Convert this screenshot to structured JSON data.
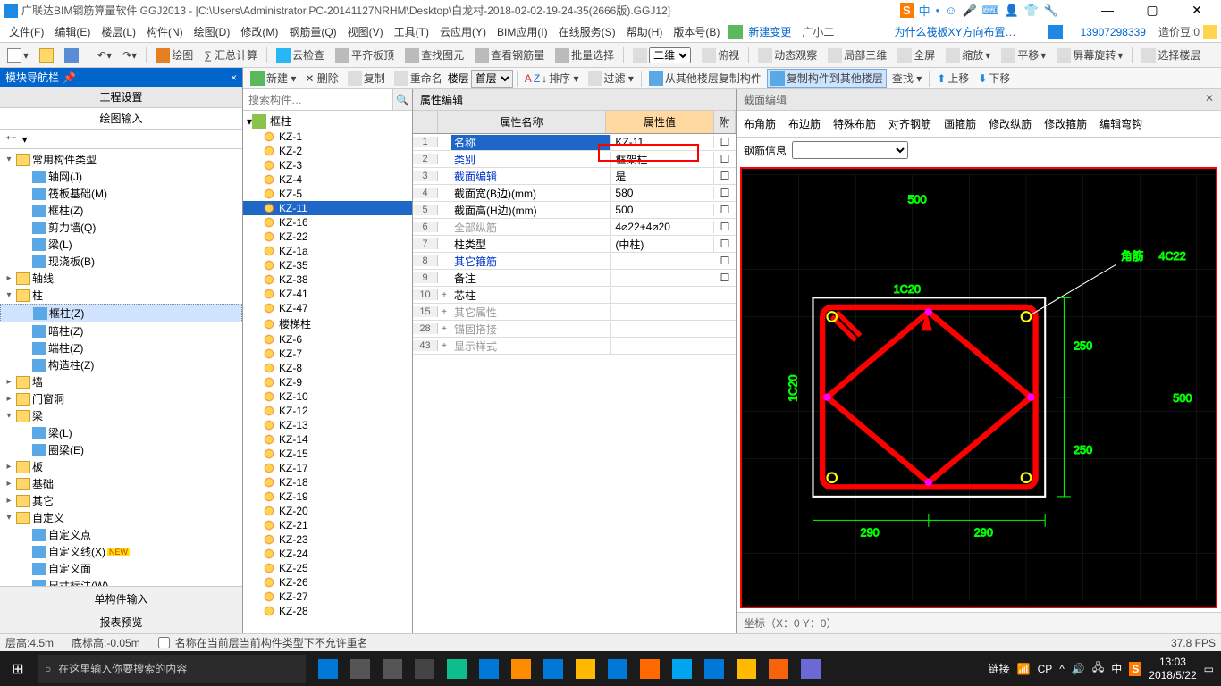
{
  "titlebar": {
    "app_icon": "app",
    "title": "广联达BIM钢筋算量软件 GGJ2013 - [C:\\Users\\Administrator.PC-20141127NRHM\\Desktop\\白龙村-2018-02-02-19-24-35(2666版).GGJ12]",
    "ime": [
      "中",
      "•",
      "☺",
      "🎤",
      "⌨",
      "👤",
      "👕",
      "🔧"
    ]
  },
  "menus": [
    "文件(F)",
    "编辑(E)",
    "楼层(L)",
    "构件(N)",
    "绘图(D)",
    "修改(M)",
    "钢筋量(Q)",
    "视图(V)",
    "工具(T)",
    "云应用(Y)",
    "BIM应用(I)",
    "在线服务(S)",
    "帮助(H)",
    "版本号(B)"
  ],
  "menu_right": {
    "new_change": "新建变更",
    "agent": "广小二",
    "ad": "为什么筏板XY方向布置…",
    "user": "13907298339",
    "coin_label": "造价豆:0"
  },
  "maintool": [
    "新建",
    "打开",
    "保存",
    "撤销",
    "重做",
    "",
    "绘图",
    "∑ 汇总计算",
    "",
    "云检查",
    "",
    "平齐板顶",
    "",
    "查找图元",
    "",
    "查看钢筋量",
    "",
    "批量选择",
    "",
    "二维",
    "",
    "俯视",
    "",
    "动态观察",
    "",
    "局部三维",
    "",
    "全屏",
    "",
    "缩放",
    "",
    "平移",
    "",
    "屏幕旋转",
    "",
    "选择楼层"
  ],
  "subtool": {
    "items": [
      "新建 ▾",
      "✕ 删除",
      "复制",
      "重命名"
    ],
    "floor_label": "楼层",
    "floor_value": "首层",
    "sort": "排序 ▾",
    "filter": "过滤 ▾",
    "copyfrom": "从其他楼层复制构件",
    "copyto": "复制构件到其他楼层",
    "find": "查找 ▾",
    "up": "上移",
    "down": "下移"
  },
  "leftpanel": {
    "header": "模块导航栏",
    "tabs": {
      "proj": "工程设置",
      "draw": "绘图输入"
    },
    "tree": [
      {
        "t": "常用构件类型",
        "exp": "-",
        "lvl": 0,
        "ic": "folder"
      },
      {
        "t": "轴网(J)",
        "lvl": 1,
        "ic": "grid"
      },
      {
        "t": "筏板基础(M)",
        "lvl": 1,
        "ic": "comp"
      },
      {
        "t": "框柱(Z)",
        "lvl": 1,
        "ic": "comp"
      },
      {
        "t": "剪力墙(Q)",
        "lvl": 1,
        "ic": "comp"
      },
      {
        "t": "梁(L)",
        "lvl": 1,
        "ic": "comp"
      },
      {
        "t": "现浇板(B)",
        "lvl": 1,
        "ic": "comp"
      },
      {
        "t": "轴线",
        "exp": "+",
        "lvl": 0,
        "ic": "folder"
      },
      {
        "t": "柱",
        "exp": "-",
        "lvl": 0,
        "ic": "folder"
      },
      {
        "t": "框柱(Z)",
        "lvl": 1,
        "ic": "comp",
        "sel": true
      },
      {
        "t": "暗柱(Z)",
        "lvl": 1,
        "ic": "comp"
      },
      {
        "t": "端柱(Z)",
        "lvl": 1,
        "ic": "comp"
      },
      {
        "t": "构造柱(Z)",
        "lvl": 1,
        "ic": "comp"
      },
      {
        "t": "墙",
        "exp": "+",
        "lvl": 0,
        "ic": "folder"
      },
      {
        "t": "门窗洞",
        "exp": "+",
        "lvl": 0,
        "ic": "folder"
      },
      {
        "t": "梁",
        "exp": "-",
        "lvl": 0,
        "ic": "folder"
      },
      {
        "t": "梁(L)",
        "lvl": 1,
        "ic": "comp"
      },
      {
        "t": "圈梁(E)",
        "lvl": 1,
        "ic": "comp"
      },
      {
        "t": "板",
        "exp": "+",
        "lvl": 0,
        "ic": "folder"
      },
      {
        "t": "基础",
        "exp": "+",
        "lvl": 0,
        "ic": "folder"
      },
      {
        "t": "其它",
        "exp": "+",
        "lvl": 0,
        "ic": "folder"
      },
      {
        "t": "自定义",
        "exp": "-",
        "lvl": 0,
        "ic": "folder"
      },
      {
        "t": "自定义点",
        "lvl": 1,
        "ic": "comp"
      },
      {
        "t": "自定义线(X)",
        "lvl": 1,
        "ic": "comp",
        "new": true
      },
      {
        "t": "自定义面",
        "lvl": 1,
        "ic": "comp"
      },
      {
        "t": "尺寸标注(W)",
        "lvl": 1,
        "ic": "comp"
      }
    ],
    "bottom": [
      "单构件输入",
      "报表预览"
    ]
  },
  "complist": {
    "search_ph": "搜索构件…",
    "root": "框柱",
    "items": [
      "KZ-1",
      "KZ-2",
      "KZ-3",
      "KZ-4",
      "KZ-5",
      "KZ-11",
      "KZ-16",
      "KZ-22",
      "KZ-1a",
      "KZ-35",
      "KZ-38",
      "KZ-41",
      "KZ-47",
      "楼梯柱",
      "KZ-6",
      "KZ-7",
      "KZ-8",
      "KZ-9",
      "KZ-10",
      "KZ-12",
      "KZ-13",
      "KZ-14",
      "KZ-15",
      "KZ-17",
      "KZ-18",
      "KZ-19",
      "KZ-20",
      "KZ-21",
      "KZ-23",
      "KZ-24",
      "KZ-25",
      "KZ-26",
      "KZ-27",
      "KZ-28"
    ],
    "selected": "KZ-11"
  },
  "prop": {
    "title": "属性编辑",
    "head": {
      "name": "属性名称",
      "value": "属性值",
      "att": "附"
    },
    "rows": [
      {
        "n": "1",
        "name": "名称",
        "val": "KZ-11",
        "sel": true,
        "blue": false
      },
      {
        "n": "2",
        "name": "类别",
        "val": "框架柱",
        "blue": true
      },
      {
        "n": "3",
        "name": "截面编辑",
        "val": "是",
        "blue": true,
        "red": true
      },
      {
        "n": "4",
        "name": "截面宽(B边)(mm)",
        "val": "580"
      },
      {
        "n": "5",
        "name": "截面高(H边)(mm)",
        "val": "500"
      },
      {
        "n": "6",
        "name": "全部纵筋",
        "val": "4⌀22+4⌀20",
        "gray": true
      },
      {
        "n": "7",
        "name": "柱类型",
        "val": "(中柱)"
      },
      {
        "n": "8",
        "name": "其它箍筋",
        "val": "",
        "blue": true
      },
      {
        "n": "9",
        "name": "备注",
        "val": ""
      },
      {
        "n": "10",
        "name": "芯柱",
        "pl": "+"
      },
      {
        "n": "15",
        "name": "其它属性",
        "pl": "+",
        "gray": true
      },
      {
        "n": "28",
        "name": "锚固搭接",
        "pl": "+",
        "gray": true
      },
      {
        "n": "43",
        "name": "显示样式",
        "pl": "+",
        "gray": true
      }
    ]
  },
  "section": {
    "title": "截面编辑",
    "tabs": [
      "布角筋",
      "布边筋",
      "特殊布筋",
      "对齐钢筋",
      "画箍筋",
      "修改纵筋",
      "修改箍筋",
      "编辑弯钩"
    ],
    "info_label": "钢筋信息",
    "dims": {
      "top": "500",
      "right1": "250",
      "right2": "250",
      "bot1": "290",
      "bot2": "290",
      "left": "500"
    },
    "labels": {
      "hoop_top": "1C20",
      "hoop_left": "1C20",
      "corner": "角筋",
      "corner_val": "4C22"
    },
    "status": "坐标（X：0 Y：0）"
  },
  "statusbar": {
    "height": "层高:4.5m",
    "bottom": "底标高:-0.05m",
    "hint": "名称在当前层当前构件类型下不允许重名",
    "fps": "37.8 FPS"
  },
  "taskbar": {
    "search_ph": "在这里输入你要搜索的内容",
    "tray_link": "链接",
    "clock_time": "13:03",
    "clock_date": "2018/5/22",
    "app_colors": [
      "#0078d7",
      "#555",
      "#555",
      "#444",
      "#0dbd8b",
      "#0078d7",
      "#ff8c00",
      "#0078d7",
      "#ffb900",
      "#0078d7",
      "#ff6a00",
      "#00a4ef",
      "#0078d7",
      "#ffb900",
      "#f7630c",
      "#6b69d6"
    ]
  }
}
